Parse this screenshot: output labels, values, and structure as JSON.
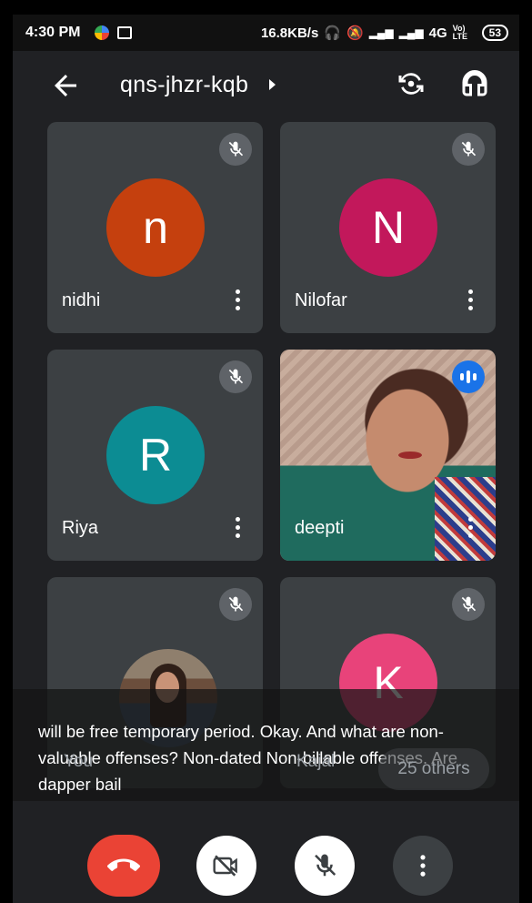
{
  "status_bar": {
    "time": "4:30 PM",
    "net_speed": "16.8KB/s",
    "network": "4G",
    "volte": "Vo) LTE",
    "battery": "53"
  },
  "header": {
    "meeting_code": "qns-jhzr-kqb"
  },
  "participants": [
    {
      "name": "nidhi",
      "initial": "n",
      "color": "#c5400e",
      "muted": true
    },
    {
      "name": "Nilofar",
      "initial": "N",
      "color": "#c2185b",
      "muted": true
    },
    {
      "name": "Riya",
      "initial": "R",
      "color": "#0c8c93",
      "muted": true
    },
    {
      "name": "deepti",
      "initial": "",
      "color": "",
      "muted": false,
      "speaking": true,
      "video": true
    },
    {
      "name": "You",
      "muted": true
    },
    {
      "name": "Kajal",
      "initial": "K",
      "color": "#e8437a",
      "muted": true
    }
  ],
  "others_label": "25 others",
  "captions": {
    "text": "will be free temporary period. Okay. And what are non-valuable offenses? Non-dated Non-billable offenses. Are dapper bail"
  },
  "controls": {
    "end_call": "end-call",
    "camera": "camera-off",
    "mic": "mic-off",
    "more": "more-options"
  },
  "colors": {
    "background": "#202124",
    "tile": "#3c4043",
    "end_call": "#ea4335",
    "speaking": "#1a73e8"
  }
}
